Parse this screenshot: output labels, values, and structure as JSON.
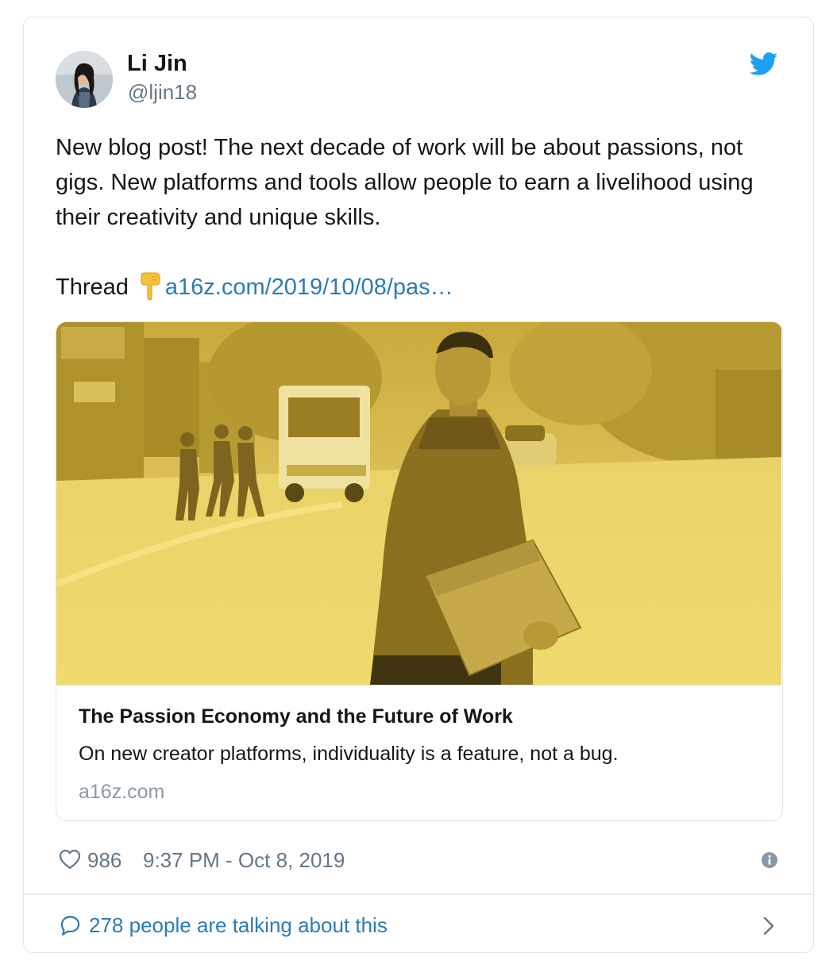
{
  "author": {
    "name": "Li Jin",
    "handle": "@ljin18"
  },
  "tweet": {
    "text": "New blog post! The next decade of work will be about passions, not gigs. New platforms and tools allow people to earn a livelihood using their creativity and unique skills.",
    "thread_label": "Thread",
    "thread_emoji": "backhand-index-pointing-down",
    "link_text": "a16z.com/2019/10/08/pas…"
  },
  "card": {
    "title": "The Passion Economy and the Future of Work",
    "description": "On new creator platforms, individuality is a feature, not a bug.",
    "domain": "a16z.com",
    "image_tint": "#e8c94a"
  },
  "meta": {
    "likes": "986",
    "timestamp": "9:37 PM - Oct 8, 2019"
  },
  "conversation": {
    "text": "278 people are talking about this"
  },
  "icons": {
    "brand": "twitter-bird-icon",
    "like": "heart-icon",
    "info": "info-icon",
    "reply": "reply-bubble-icon",
    "more": "chevron-right-icon"
  },
  "colors": {
    "twitter_blue": "#1da1f2",
    "link_blue": "#2b7bb9",
    "muted_gray": "#657786",
    "domain_gray": "#8899a6",
    "border": "#dfe6eb"
  }
}
